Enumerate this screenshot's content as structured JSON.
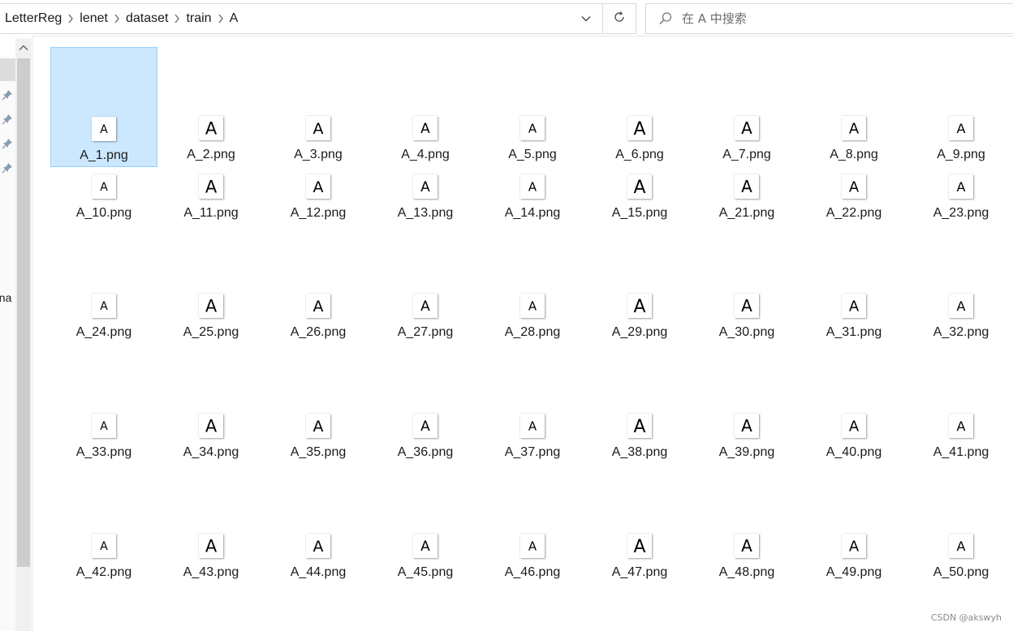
{
  "address_bar": {
    "breadcrumbs": [
      "LetterReg",
      "lenet",
      "dataset",
      "train",
      "A"
    ],
    "dropdown_icon": "chevron-down-icon",
    "refresh_icon": "refresh-icon"
  },
  "search": {
    "placeholder": "在 A 中搜索",
    "icon": "search-icon"
  },
  "nav_pane": {
    "pinned_icons": [
      "pin-icon",
      "pin-icon",
      "pin-icon",
      "pin-icon"
    ],
    "partial_label": "ona"
  },
  "files": [
    {
      "name": "A_1.png",
      "selected": true
    },
    {
      "name": "A_2.png"
    },
    {
      "name": "A_3.png"
    },
    {
      "name": "A_4.png"
    },
    {
      "name": "A_5.png"
    },
    {
      "name": "A_6.png"
    },
    {
      "name": "A_7.png"
    },
    {
      "name": "A_8.png"
    },
    {
      "name": "A_9.png"
    },
    {
      "name": "A_10.png"
    },
    {
      "name": "A_11.png"
    },
    {
      "name": "A_12.png"
    },
    {
      "name": "A_13.png"
    },
    {
      "name": "A_14.png"
    },
    {
      "name": "A_15.png"
    },
    {
      "name": "A_21.png"
    },
    {
      "name": "A_22.png"
    },
    {
      "name": "A_23.png"
    },
    {
      "name": "A_24.png"
    },
    {
      "name": "A_25.png"
    },
    {
      "name": "A_26.png"
    },
    {
      "name": "A_27.png"
    },
    {
      "name": "A_28.png"
    },
    {
      "name": "A_29.png"
    },
    {
      "name": "A_30.png"
    },
    {
      "name": "A_31.png"
    },
    {
      "name": "A_32.png"
    },
    {
      "name": "A_33.png"
    },
    {
      "name": "A_34.png"
    },
    {
      "name": "A_35.png"
    },
    {
      "name": "A_36.png"
    },
    {
      "name": "A_37.png"
    },
    {
      "name": "A_38.png"
    },
    {
      "name": "A_39.png"
    },
    {
      "name": "A_40.png"
    },
    {
      "name": "A_41.png"
    },
    {
      "name": "A_42.png"
    },
    {
      "name": "A_43.png"
    },
    {
      "name": "A_44.png"
    },
    {
      "name": "A_45.png"
    },
    {
      "name": "A_46.png"
    },
    {
      "name": "A_47.png"
    },
    {
      "name": "A_48.png"
    },
    {
      "name": "A_49.png"
    },
    {
      "name": "A_50.png"
    }
  ],
  "thumbnail_glyph": "A",
  "watermark": "CSDN @akswyh",
  "colors": {
    "selection_bg": "#cce8ff",
    "selection_border": "#99d1ff",
    "text": "#1a1a1a"
  }
}
